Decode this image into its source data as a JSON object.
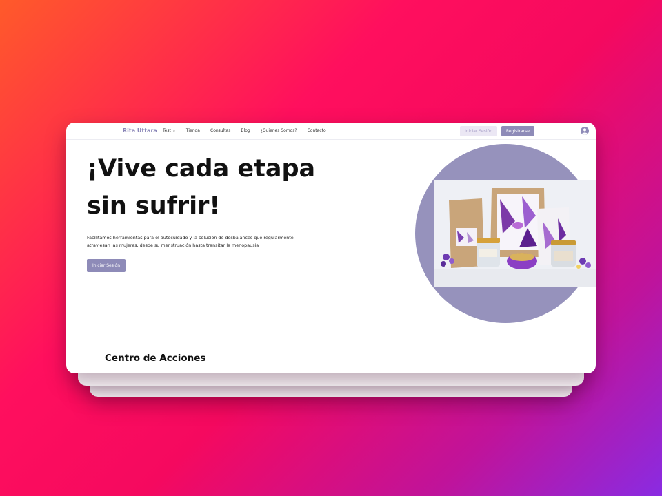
{
  "nav": {
    "brand": "Rita Uttara",
    "links": [
      "Test",
      "Tienda",
      "Consultas",
      "Blog",
      "¿Quienes Somos?",
      "Contacto"
    ],
    "login_label": "Iniciar Sesión",
    "register_label": "Registrarse"
  },
  "hero": {
    "title_line1": "¡Vive cada etapa",
    "title_line2": "sin sufrir!",
    "description": "Facilitamos herramientas para el autocuidado y la solución de desbalances que regularmente atraviesan las mujeres, desde su menstruación hasta transitar la menopausia",
    "cta_label": "Iniciar Sesión"
  },
  "sections": {
    "actions_title": "Centro de Acciones"
  },
  "colors": {
    "accent": "#8e8bb8",
    "circle": "#9692bc",
    "brand_text": "#8a86b8"
  }
}
